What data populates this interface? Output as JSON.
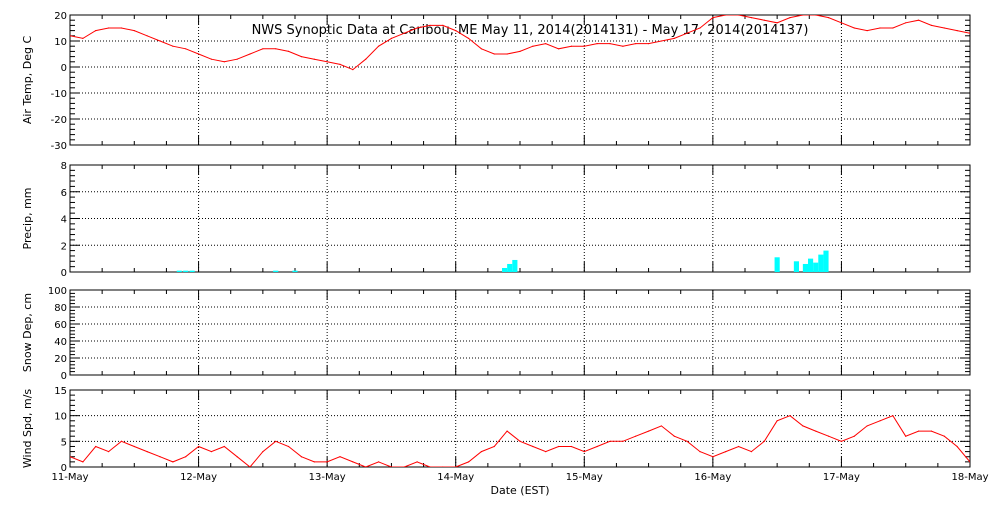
{
  "title": "NWS Synoptic Data at Caribou, ME   May 11, 2014(2014131) - May 17, 2014(2014137)",
  "colors": {
    "temp": "#ff0000",
    "precip": "#00ffff",
    "snow": "#ff0000",
    "wind": "#ff0000",
    "axis": "#000000"
  },
  "xaxis": {
    "label": "Date (EST)",
    "ticks": [
      "11-May",
      "12-May",
      "13-May",
      "14-May",
      "15-May",
      "16-May",
      "17-May",
      "18-May"
    ],
    "range_days": [
      0,
      7
    ]
  },
  "chart_data": [
    {
      "id": "temp",
      "type": "line",
      "ylabel": "Air Temp, Deg C",
      "ylim": [
        -30,
        20
      ],
      "yticks": [
        20,
        10,
        0,
        -10,
        -20,
        -30
      ],
      "x": [
        0,
        0.1,
        0.2,
        0.3,
        0.4,
        0.5,
        0.6,
        0.7,
        0.8,
        0.9,
        1.0,
        1.1,
        1.2,
        1.3,
        1.4,
        1.5,
        1.6,
        1.7,
        1.8,
        1.9,
        2.0,
        2.1,
        2.2,
        2.3,
        2.4,
        2.5,
        2.6,
        2.7,
        2.8,
        2.9,
        3.0,
        3.1,
        3.2,
        3.3,
        3.4,
        3.5,
        3.6,
        3.7,
        3.8,
        3.9,
        4.0,
        4.1,
        4.2,
        4.3,
        4.4,
        4.5,
        4.6,
        4.7,
        4.8,
        4.9,
        5.0,
        5.1,
        5.2,
        5.3,
        5.4,
        5.5,
        5.6,
        5.7,
        5.8,
        5.9,
        6.0,
        6.1,
        6.2,
        6.3,
        6.4,
        6.5,
        6.6,
        6.7,
        6.8,
        6.9,
        7.0
      ],
      "y": [
        12,
        11,
        14,
        15,
        15,
        14,
        12,
        10,
        8,
        7,
        5,
        3,
        2,
        3,
        5,
        7,
        7,
        6,
        4,
        3,
        2,
        1,
        -1,
        3,
        8,
        11,
        13,
        15,
        16,
        16,
        14,
        11,
        7,
        5,
        5,
        6,
        8,
        9,
        7,
        8,
        8,
        9,
        9,
        8,
        9,
        9,
        10,
        11,
        13,
        15,
        19,
        20,
        20,
        19,
        18,
        17,
        19,
        20,
        20,
        19,
        17,
        15,
        14,
        15,
        15,
        17,
        18,
        16,
        15,
        14,
        13
      ],
      "unit": "Deg C"
    },
    {
      "id": "precip",
      "type": "bar",
      "ylabel": "Precip, mm",
      "ylim": [
        0,
        8
      ],
      "yticks": [
        8,
        6,
        4,
        2,
        0
      ],
      "x": [
        0.85,
        0.9,
        0.95,
        1.6,
        1.75,
        3.38,
        3.42,
        3.46,
        5.5,
        5.65,
        5.72,
        5.76,
        5.8,
        5.84,
        5.88
      ],
      "values": [
        0.1,
        0.1,
        0.1,
        0.1,
        0.1,
        0.3,
        0.6,
        0.9,
        1.1,
        0.8,
        0.6,
        1.0,
        0.7,
        1.3,
        1.6
      ],
      "bar_width_days": 0.04,
      "unit": "mm"
    },
    {
      "id": "snow",
      "type": "line",
      "ylabel": "Snow Dep, cm",
      "ylim": [
        0,
        100
      ],
      "yticks": [
        100,
        80,
        60,
        40,
        20,
        0
      ],
      "x": [],
      "y": [],
      "unit": "cm"
    },
    {
      "id": "wind",
      "type": "line",
      "ylabel": "Wind Spd, m/s",
      "ylim": [
        0,
        15
      ],
      "yticks": [
        15,
        10,
        5,
        0
      ],
      "x": [
        0,
        0.1,
        0.2,
        0.3,
        0.4,
        0.5,
        0.6,
        0.7,
        0.8,
        0.9,
        1.0,
        1.1,
        1.2,
        1.3,
        1.4,
        1.5,
        1.6,
        1.7,
        1.8,
        1.9,
        2.0,
        2.1,
        2.2,
        2.3,
        2.4,
        2.5,
        2.6,
        2.7,
        2.8,
        2.9,
        3.0,
        3.1,
        3.2,
        3.3,
        3.4,
        3.5,
        3.6,
        3.7,
        3.8,
        3.9,
        4.0,
        4.1,
        4.2,
        4.3,
        4.4,
        4.5,
        4.6,
        4.7,
        4.8,
        4.9,
        5.0,
        5.1,
        5.2,
        5.3,
        5.4,
        5.5,
        5.6,
        5.7,
        5.8,
        5.9,
        6.0,
        6.1,
        6.2,
        6.3,
        6.4,
        6.5,
        6.6,
        6.7,
        6.8,
        6.9,
        7.0
      ],
      "y": [
        2,
        1,
        4,
        3,
        5,
        4,
        3,
        2,
        1,
        2,
        4,
        3,
        4,
        2,
        0,
        3,
        5,
        4,
        2,
        1,
        1,
        2,
        1,
        0,
        1,
        0,
        0,
        1,
        0,
        0,
        0,
        1,
        3,
        4,
        7,
        5,
        4,
        3,
        4,
        4,
        3,
        4,
        5,
        5,
        6,
        7,
        8,
        6,
        5,
        3,
        2,
        3,
        4,
        3,
        5,
        9,
        10,
        8,
        7,
        6,
        5,
        6,
        8,
        9,
        10,
        6,
        7,
        7,
        6,
        4,
        1
      ],
      "unit": "m/s"
    }
  ]
}
